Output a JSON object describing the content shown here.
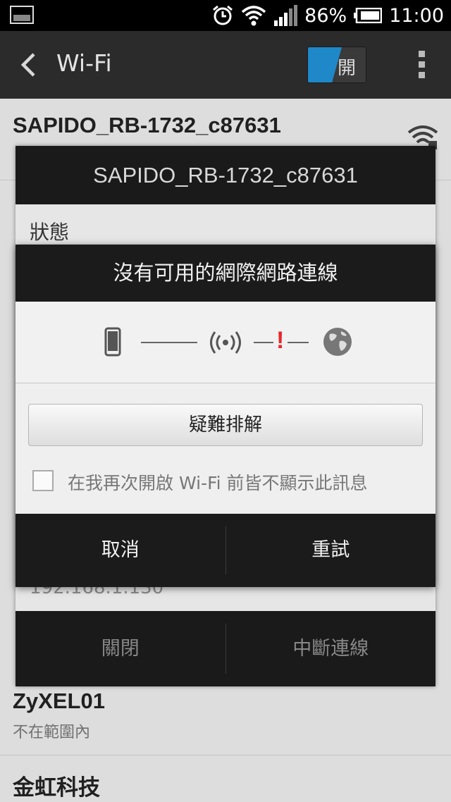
{
  "status_bar": {
    "battery_percent": "86%",
    "time": "11:00",
    "icons": [
      "screenshot-icon",
      "alarm-icon",
      "wifi-icon",
      "signal-icon",
      "battery-icon"
    ]
  },
  "action_bar": {
    "title": "Wi-Fi",
    "toggle_label": "開",
    "toggle_color": "#1e88c8"
  },
  "networks": [
    {
      "name": "SAPIDO_RB-1732_c87631",
      "status": ""
    },
    {
      "name": "ZyXEL01",
      "status": "不在範圍內"
    },
    {
      "name": "金虹科技",
      "status": ""
    }
  ],
  "network_dialog": {
    "title": "SAPIDO_RB-1732_c87631",
    "status_label": "狀態",
    "ip_address": "192.168.1.130",
    "close_button": "關閉",
    "disconnect_button": "中斷連線"
  },
  "no_internet_dialog": {
    "title": "沒有可用的網際網路連線",
    "diagram": {
      "icons": [
        "phone-icon",
        "access-point-icon",
        "globe-icon"
      ],
      "error_mark": "!",
      "error_color": "#e8262b"
    },
    "troubleshoot_button": "疑難排解",
    "dont_show_checkbox_label": "在我再次開啟 Wi-Fi 前皆不顯示此訊息",
    "dont_show_checked": false,
    "cancel_button": "取消",
    "retry_button": "重試"
  }
}
